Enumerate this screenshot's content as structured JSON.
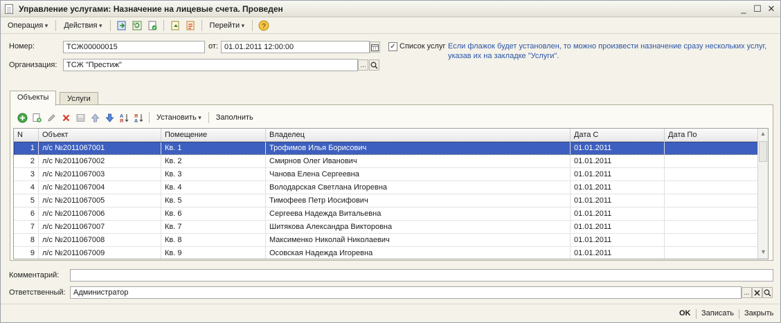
{
  "window": {
    "title": "Управление услугами: Назначение на лицевые счета. Проведен",
    "controls": {
      "minimize": "_",
      "maximize": "☐",
      "close": "✕"
    }
  },
  "toolbar": {
    "operation": "Операция",
    "actions": "Действия",
    "goto": "Перейти",
    "help": "?"
  },
  "form": {
    "number_label": "Номер:",
    "number_value": "ТСЖ00000015",
    "date_label": "от:",
    "date_value": "01.01.2011 12:00:00",
    "services_list_label": "Список услуг",
    "services_list_checked": true,
    "services_hint": "Если флажок будет установлен, то можно произвести назначение сразу нескольких услуг, указав их на закладке \"Услуги\".",
    "org_label": "Организация:",
    "org_value": "ТСЖ \"Престиж\"",
    "select_glyph": "...",
    "comment_label": "Комментарий:",
    "comment_value": "",
    "responsible_label": "Ответственный:",
    "responsible_value": "Администратор"
  },
  "tabs": [
    {
      "label": "Объекты"
    },
    {
      "label": "Услуги"
    }
  ],
  "grid_toolbar": {
    "set": "Установить",
    "fill": "Заполнить"
  },
  "table": {
    "columns": [
      "N",
      "Объект",
      "Помещение",
      "Владелец",
      "Дата С",
      "Дата По"
    ],
    "rows": [
      [
        "1",
        "л/с №2011067001",
        "Кв. 1",
        "Трофимов Илья Борисович",
        "01.01.2011",
        ""
      ],
      [
        "2",
        "л/с №2011067002",
        "Кв. 2",
        "Смирнов Олег Иванович",
        "01.01.2011",
        ""
      ],
      [
        "3",
        "л/с №2011067003",
        "Кв. 3",
        "Чанова Елена Сергеевна",
        "01.01.2011",
        ""
      ],
      [
        "4",
        "л/с №2011067004",
        "Кв. 4",
        "Володарская Светлана Игоревна",
        "01.01.2011",
        ""
      ],
      [
        "5",
        "л/с №2011067005",
        "Кв. 5",
        "Тимофеев Петр Иосифович",
        "01.01.2011",
        ""
      ],
      [
        "6",
        "л/с №2011067006",
        "Кв. 6",
        "Сергеева Надежда Витальевна",
        "01.01.2011",
        ""
      ],
      [
        "7",
        "л/с №2011067007",
        "Кв. 7",
        "Шитякова Александра Викторовна",
        "01.01.2011",
        ""
      ],
      [
        "8",
        "л/с №2011067008",
        "Кв. 8",
        "Максименко Николай Николаевич",
        "01.01.2011",
        ""
      ],
      [
        "9",
        "л/с №2011067009",
        "Кв. 9",
        "Осовская Надежда Игоревна",
        "01.01.2011",
        ""
      ]
    ],
    "selected_row": 0
  },
  "footer": {
    "ok": "OK",
    "save": "Записать",
    "close": "Закрыть"
  },
  "colors": {
    "selection": "#3d5fbf",
    "hint": "#2c55a6",
    "frame": "#f4f2e9"
  }
}
